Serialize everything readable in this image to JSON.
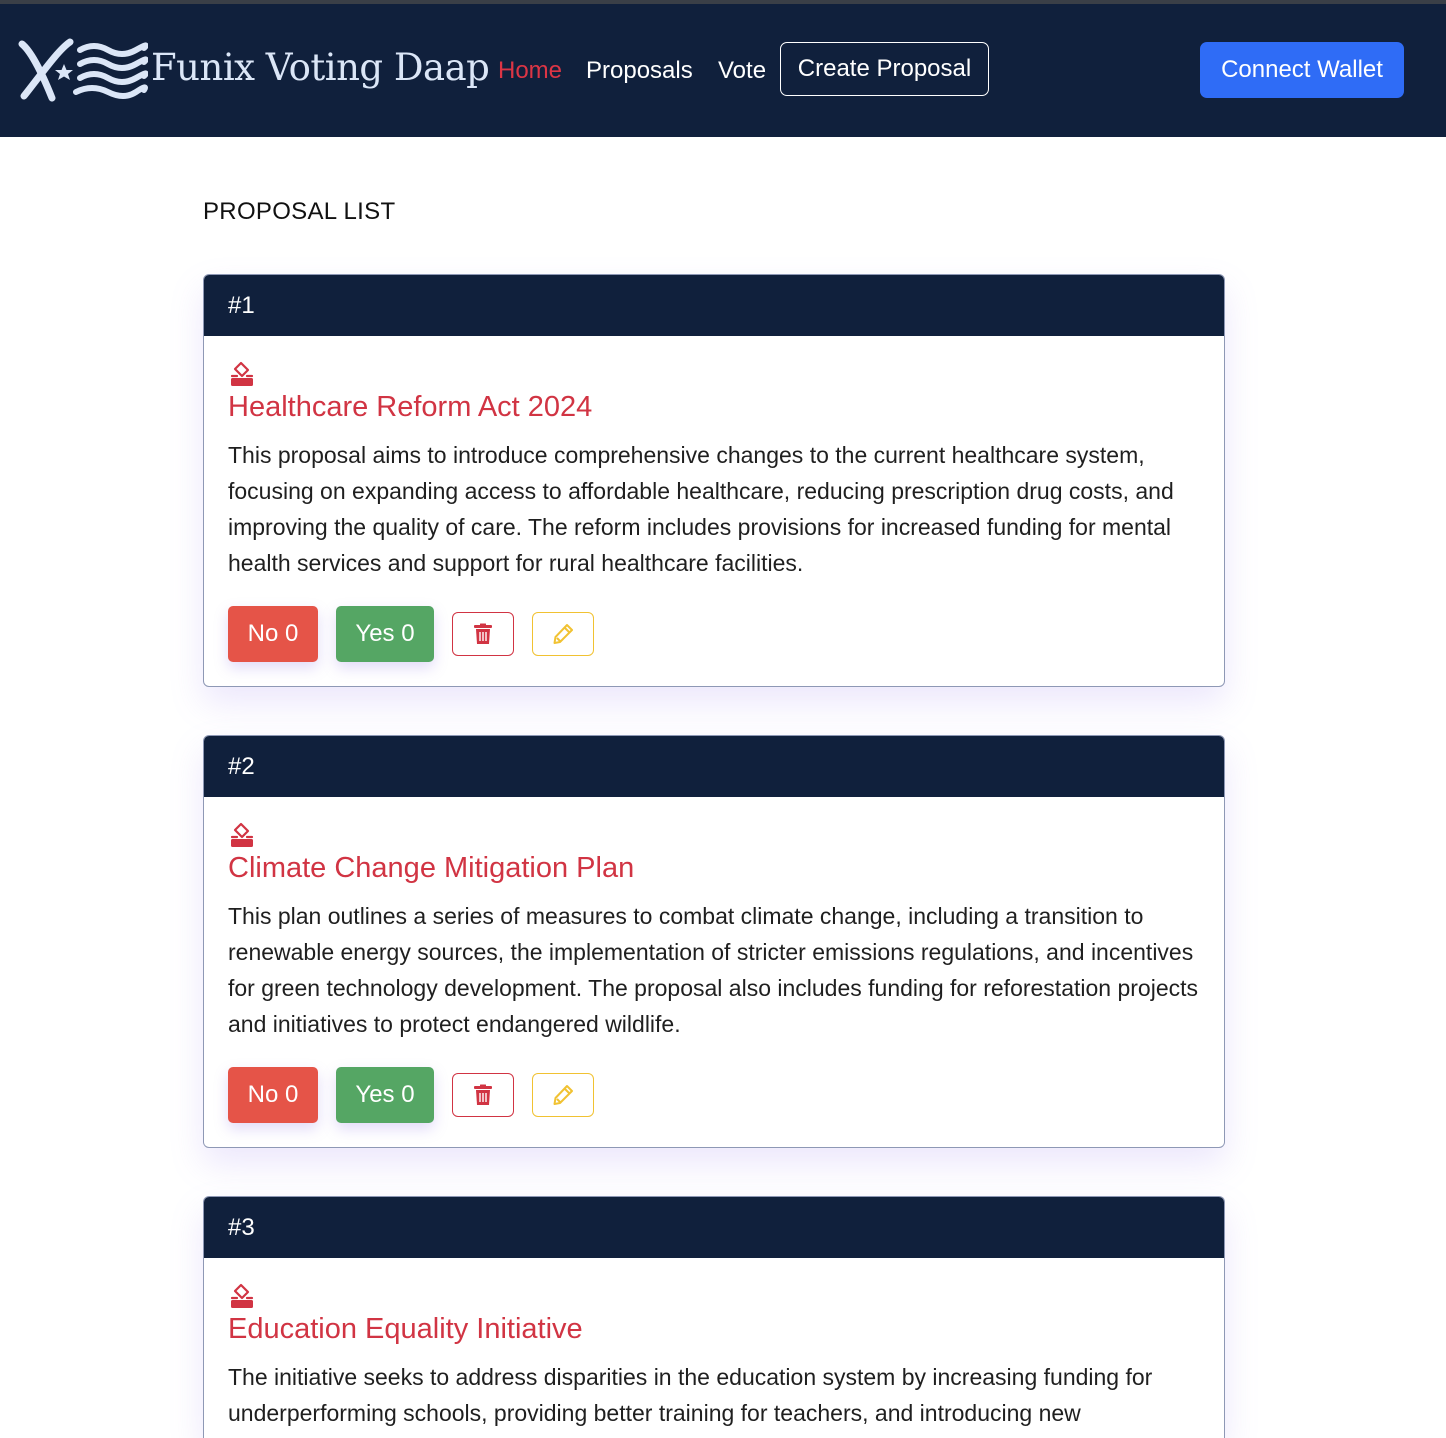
{
  "navbar": {
    "brand": "Funix Voting Daap",
    "links": [
      {
        "label": "Home",
        "active": true
      },
      {
        "label": "Proposals",
        "active": false
      },
      {
        "label": "Vote",
        "active": false
      }
    ],
    "create_label": "Create Proposal",
    "connect_label": "Connect Wallet"
  },
  "main": {
    "list_title": "PROPOSAL LIST",
    "proposals": [
      {
        "number": "#1",
        "title": "Healthcare Reform Act 2024",
        "description": "This proposal aims to introduce comprehensive changes to the current healthcare system, focusing on expanding access to affordable healthcare, reducing prescription drug costs, and improving the quality of care. The reform includes provisions for increased funding for mental health services and support for rural healthcare facilities.",
        "no_label": "No 0",
        "yes_label": "Yes 0"
      },
      {
        "number": "#2",
        "title": "Climate Change Mitigation Plan",
        "description": "This plan outlines a series of measures to combat climate change, including a transition to renewable energy sources, the implementation of stricter emissions regulations, and incentives for green technology development. The proposal also includes funding for reforestation projects and initiatives to protect endangered wildlife.",
        "no_label": "No 0",
        "yes_label": "Yes 0"
      },
      {
        "number": "#3",
        "title": "Education Equality Initiative",
        "description": "The initiative seeks to address disparities in the education system by increasing funding for underperforming schools, providing better training for teachers, and introducing new"
      }
    ]
  },
  "icons": {
    "logo": "flag-star-x-logo",
    "vote": "ballot-box-icon",
    "delete": "trash-icon",
    "edit": "pencil-icon"
  },
  "colors": {
    "navbar_bg": "#10203c",
    "accent_red": "#d13443",
    "no_button": "#e55448",
    "yes_button": "#55a664",
    "connect_button": "#2f6cf6",
    "edit_border": "#f1c232"
  }
}
